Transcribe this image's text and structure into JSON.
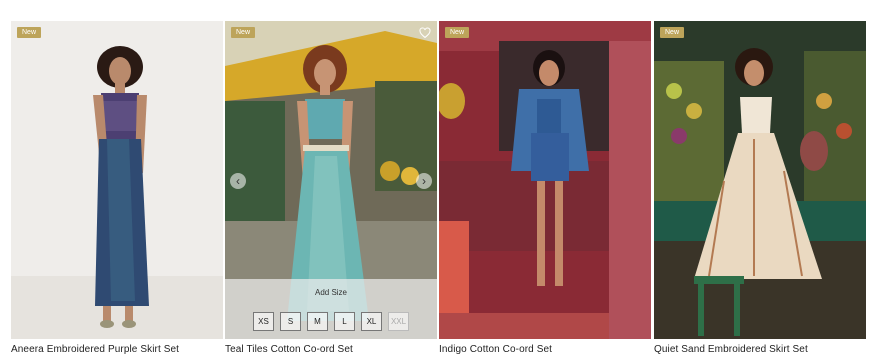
{
  "products": [
    {
      "badge": "New",
      "name": "Aneera Embroidered Purple Skirt Set",
      "image_icon": "model-photo-purple-skirt-set"
    },
    {
      "badge": "New",
      "name": "Teal Tiles Cotton Co-ord Set",
      "image_icon": "model-photo-teal-coord-set"
    },
    {
      "badge": "New",
      "name": "Indigo Cotton Co-ord Set",
      "image_icon": "model-photo-indigo-coord-set"
    },
    {
      "badge": "New",
      "name": "Quiet Sand Embroidered Skirt Set",
      "image_icon": "model-photo-sand-skirt-set"
    }
  ],
  "quick_add": {
    "title": "Add Size",
    "sizes": [
      "XS",
      "S",
      "M",
      "L",
      "XL",
      "XXL"
    ],
    "unavailable": [
      "XXL"
    ]
  },
  "carousel": {
    "prev_icon": "chevron-left-icon",
    "next_icon": "chevron-right-icon",
    "prev": "‹",
    "next": "›"
  },
  "colors": {
    "badge": "#bda45a"
  }
}
